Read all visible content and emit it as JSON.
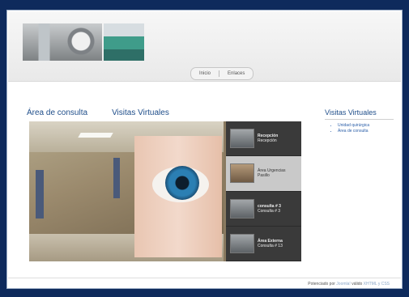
{
  "header": {
    "nav": [
      "Inicio",
      "Enlaces"
    ]
  },
  "tabs": [
    "Área de consulta",
    "Visitas Virtuales"
  ],
  "gallery": {
    "thumbs": [
      {
        "title": "Recepción",
        "subtitle": "Recepción",
        "active": false
      },
      {
        "title": "Área Urgencias Pasillo",
        "subtitle": "",
        "active": true
      },
      {
        "title": "consulta # 3",
        "subtitle": "Consulta # 3",
        "active": false
      },
      {
        "title": "Área Externa",
        "subtitle": "Consulta # 13",
        "active": false
      }
    ]
  },
  "sidebar": {
    "title": "Visitas Virtuales",
    "links": [
      "Unidad quirúrgica",
      "Área de consulta"
    ]
  },
  "footer": {
    "prefix": "Potenciado por",
    "link1": "Joomla!",
    "middle": "válido",
    "link2": "XHTML y CSS"
  },
  "colors": {
    "background": "#0e2a5c",
    "accent": "#1f4e8a"
  }
}
